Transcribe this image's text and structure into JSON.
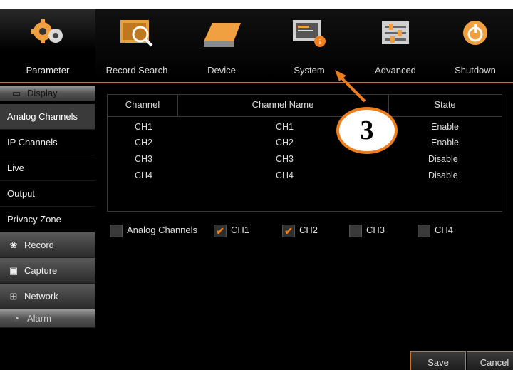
{
  "toolbar": {
    "items": [
      {
        "label": "Parameter",
        "icon": "gears-icon"
      },
      {
        "label": "Record Search",
        "icon": "film-search-icon"
      },
      {
        "label": "Device",
        "icon": "hard-drive-icon"
      },
      {
        "label": "System",
        "icon": "system-info-icon"
      },
      {
        "label": "Advanced",
        "icon": "sliders-icon"
      },
      {
        "label": "Shutdown",
        "icon": "power-icon"
      }
    ]
  },
  "sidebar": {
    "display": "Display",
    "items": [
      "Analog Channels",
      "IP Channels",
      "Live",
      "Output",
      "Privacy Zone"
    ],
    "record": "Record",
    "capture": "Capture",
    "network": "Network",
    "alarm": "Alarm"
  },
  "table": {
    "headers": [
      "Channel",
      "Channel Name",
      "State"
    ],
    "rows": [
      {
        "channel": "CH1",
        "name": "CH1",
        "state": "Enable"
      },
      {
        "channel": "CH2",
        "name": "CH2",
        "state": "Enable"
      },
      {
        "channel": "CH3",
        "name": "CH3",
        "state": "Disable"
      },
      {
        "channel": "CH4",
        "name": "CH4",
        "state": "Disable"
      }
    ]
  },
  "checkboxes": {
    "all": {
      "label": "Analog Channels",
      "checked": false
    },
    "ch1": {
      "label": "CH1",
      "checked": true
    },
    "ch2": {
      "label": "CH2",
      "checked": true
    },
    "ch3": {
      "label": "CH3",
      "checked": false
    },
    "ch4": {
      "label": "CH4",
      "checked": false
    }
  },
  "buttons": {
    "save": "Save",
    "cancel": "Cancel"
  },
  "annotation": {
    "number": "3"
  },
  "colors": {
    "accent": "#ee7d1e",
    "background": "#000000"
  }
}
